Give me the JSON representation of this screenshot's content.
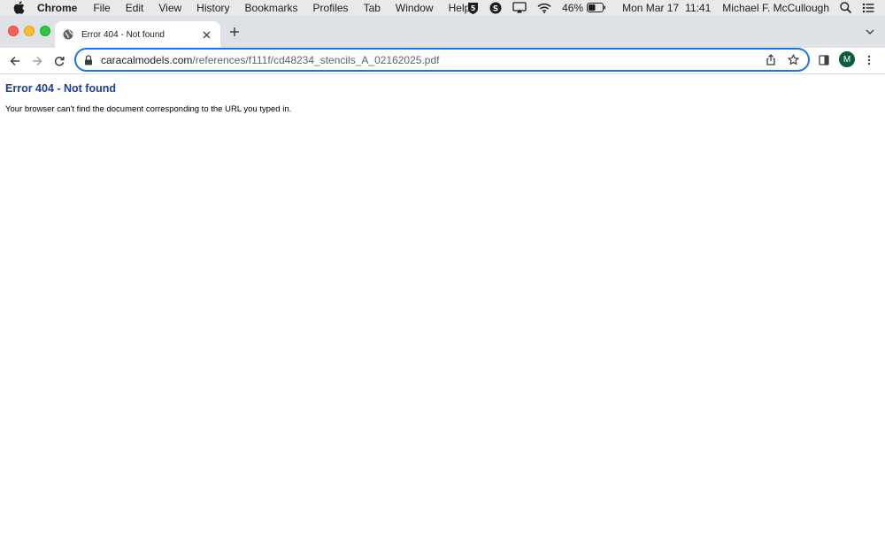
{
  "menubar": {
    "app_name": "Chrome",
    "items": [
      "File",
      "Edit",
      "View",
      "History",
      "Bookmarks",
      "Profiles",
      "Tab",
      "Window",
      "Help"
    ],
    "battery_percent": "46%",
    "date": "Mon Mar 17",
    "time": "11:41",
    "user_name": "Michael F. McCullough"
  },
  "tab": {
    "title": "Error 404 - Not found",
    "favicon": "globe-icon"
  },
  "omnibox": {
    "domain": "caracalmodels.com",
    "path": "/references/f111f/cd48234_stencils_A_02162025.pdf"
  },
  "profile": {
    "initial": "M"
  },
  "page": {
    "heading": "Error 404 - Not found",
    "message": "Your browser can't find the document corresponding to the URL you typed in."
  },
  "colors": {
    "heading": "#1c3f95",
    "omnibox_focus": "#1a73e8",
    "avatar": "#0d5c3f"
  }
}
